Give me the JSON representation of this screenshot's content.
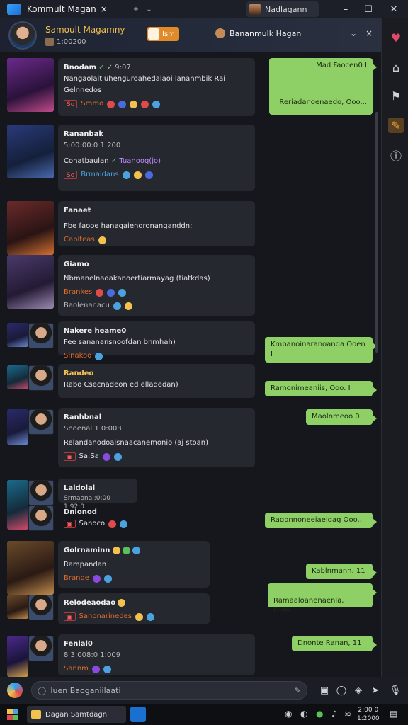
{
  "titlebar": {
    "tab_title": "Kommult Magan",
    "tab_close": "×",
    "tab_add": "+",
    "tab_menu": "⌄",
    "profile_name": "Nadlagann",
    "min": "–",
    "restore": "☐",
    "close": "✕"
  },
  "header": {
    "name": "Samoult Magamny",
    "sub": "1:00200",
    "badge": "Ism",
    "right_title": "Bananmulk Hagan",
    "chevron": "⌄",
    "close": "×"
  },
  "sidebar": [
    "♥",
    "⌂",
    "⚑",
    "✎",
    "ⓘ"
  ],
  "messages": [
    {
      "sender": "Bnodam",
      "sender_suffix": "✓ 9:07",
      "line1": "Nangaolaitiuhenguroahedalaoi lananmbik Rai",
      "line2": "Gelnnedos",
      "tags": "So",
      "row": "Smmo"
    },
    {
      "sender": "Rananbak",
      "meta": "5:00:00:0 1:200",
      "line1": "Conatbaulan",
      "line1b": "Tuanoog(jo)",
      "tags": "So",
      "row": "Brmaidans"
    },
    {
      "sender": "Fanaet",
      "line1": "Fbe faooe hanagaienoronanganddn;",
      "row": "Cabiteas"
    },
    {
      "sender": "Giamo",
      "line1": "Nbmanelnadakanoertiarmayag (tiatkdas)",
      "row": "Brankes",
      "line2": "Baolenanacu"
    },
    {
      "sender": "Nakere heame0",
      "line1": "Fee sananansnoofdan bnmhah)",
      "row": "Sinakoo"
    },
    {
      "sender": "Randeo",
      "line1": "Rabo Csecnadeon ed elladedan)"
    },
    {
      "sender": "Ranhbnal",
      "meta": "Snoenal 1 0:003",
      "line1": "Relandanodoalsnaacanemonio (aj stoan)",
      "row": "Sa:Sa"
    },
    {
      "sender": "Laldolal",
      "meta": "Srmaonal:0:00 1:92:0"
    },
    {
      "sender": "Dnionod",
      "row": "Sanoco"
    },
    {
      "sender": "Golrnaminn",
      "line1": "Rampandan",
      "row": "Brande"
    },
    {
      "sender": "Relodeaodao",
      "row": "Sanonarinedes"
    },
    {
      "sender": "Fenlal0",
      "meta": "8 3:008:0 1:009",
      "row": "Sannm"
    }
  ],
  "replies": [
    {
      "line1": "Mad Faocen0 I",
      "line2": "Reriadanoenaedo, Ooo..."
    },
    {
      "line1": "Kmbanoinaranoanda Ooen I"
    },
    {
      "line1": "Ramonimeaniis, Ooo. I"
    },
    {
      "line1": "Maolnmeoo 0"
    },
    {
      "line1": "Ragonnoneeiaeidag Ooo..."
    },
    {
      "line1": "Kablnmann. 11"
    },
    {
      "line1": "Ramaaloanenaenla, Oinn..."
    },
    {
      "line1": "Dnonte Ranan, 11"
    }
  ],
  "composer": {
    "placeholder": "Iuen Baoganiilaati"
  },
  "taskbar": {
    "task_label": "Dagan Samtdagn",
    "time": "2:00 0",
    "date": "1:2000"
  }
}
